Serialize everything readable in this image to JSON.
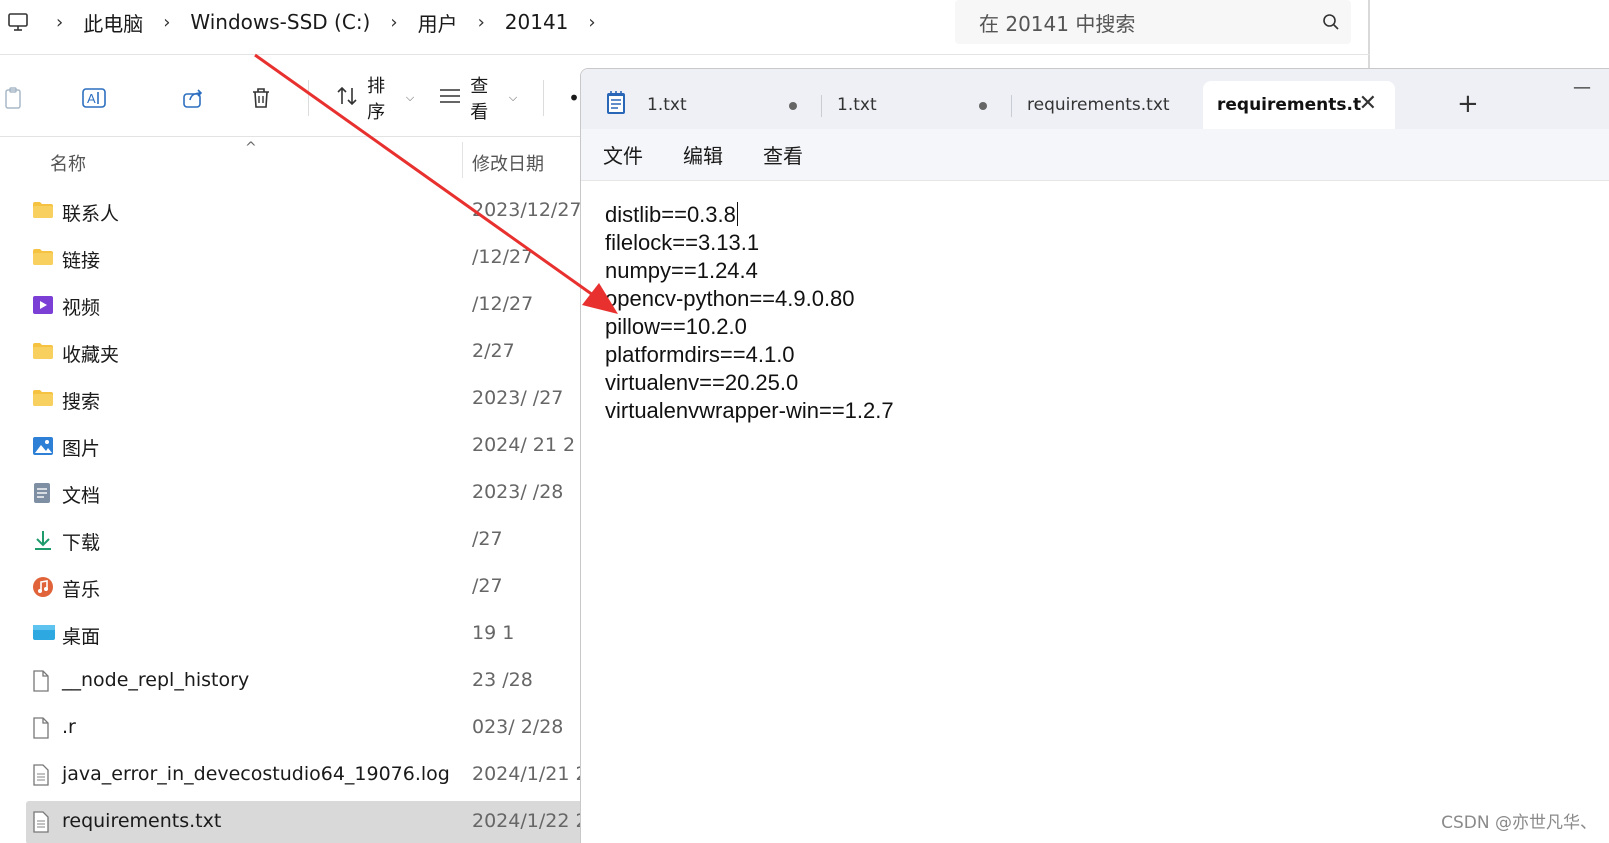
{
  "explorer": {
    "breadcrumb": [
      "此电脑",
      "Windows-SSD (C:)",
      "用户",
      "20141"
    ],
    "search_placeholder": "在 20141 中搜索",
    "toolbar": {
      "sort_label": "排序",
      "view_label": "查看"
    },
    "columns": {
      "name": "名称",
      "date": "修改日期"
    },
    "files": [
      {
        "name": "联系人",
        "date": "2023/12/27",
        "icon": "folder-icon"
      },
      {
        "name": "链接",
        "date": "/12/27",
        "icon": "folder-icon"
      },
      {
        "name": "视频",
        "date": "/12/27",
        "icon": "video-folder-icon"
      },
      {
        "name": "收藏夹",
        "date": "2/27",
        "icon": "folder-icon"
      },
      {
        "name": "搜索",
        "date": "2023/  /27",
        "icon": "folder-icon"
      },
      {
        "name": "图片",
        "date": "2024/  21 2",
        "icon": "pictures-folder-icon"
      },
      {
        "name": "文档",
        "date": "2023/  /28",
        "icon": "documents-folder-icon"
      },
      {
        "name": "下载",
        "date": "/27",
        "icon": "downloads-folder-icon"
      },
      {
        "name": "音乐",
        "date": "/27",
        "icon": "music-folder-icon"
      },
      {
        "name": "桌面",
        "date": "19 1",
        "icon": "desktop-folder-icon"
      },
      {
        "name": "__node_repl_history",
        "date": "23  /28",
        "icon": "file-icon"
      },
      {
        "name": ".r",
        "date": "023/ 2/28",
        "icon": "file-icon"
      },
      {
        "name": "java_error_in_devecostudio64_19076.log",
        "date": "2024/1/21 2",
        "icon": "log-file-icon"
      },
      {
        "name": "requirements.txt",
        "date": "2024/1/22 2",
        "icon": "text-file-icon"
      }
    ]
  },
  "notepad": {
    "tabs": [
      {
        "label": "1.txt",
        "modified": true
      },
      {
        "label": "1.txt",
        "modified": true
      },
      {
        "label": "requirements.txt",
        "modified": false
      },
      {
        "label": "requirements.t",
        "modified": false
      }
    ],
    "new_tab": "+",
    "minimize": "—",
    "menu": [
      "文件",
      "编辑",
      "查看"
    ],
    "lines": [
      "distlib==0.3.8",
      "filelock==3.13.1",
      "numpy==1.24.4",
      "opencv-python==4.9.0.80",
      "pillow==10.2.0",
      "platformdirs==4.1.0",
      "virtualenv==20.25.0",
      "virtualenvwrapper-win==1.2.7"
    ]
  },
  "watermark": "CSDN @亦世凡华、",
  "colors": {
    "arrow": "#e8312f",
    "selection": "#d9d9d9",
    "folder": "#f5c242"
  }
}
